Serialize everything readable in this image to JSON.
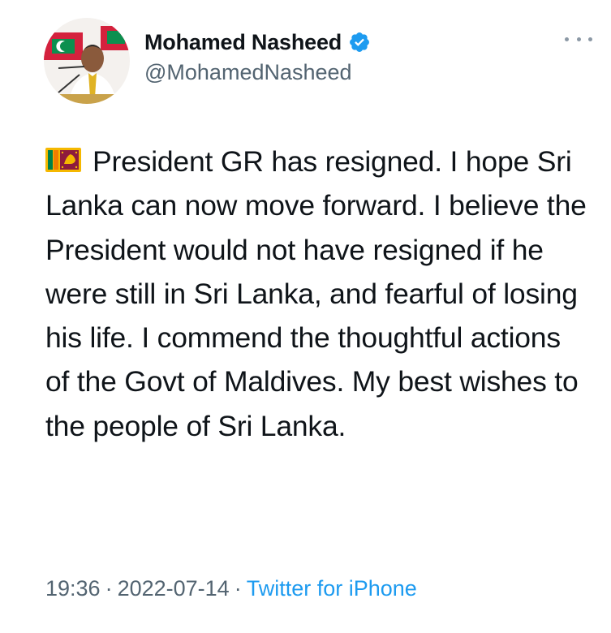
{
  "author": {
    "display_name": "Mohamed Nasheed",
    "handle": "@MohamedNasheed",
    "verified": true,
    "avatar_icon": "profile-photo-avatar",
    "verified_icon": "verified-badge-icon",
    "verified_color": "#1d9bf0"
  },
  "menu": {
    "icon": "more-options-icon"
  },
  "tweet": {
    "flag_icon": "sri-lanka-flag-emoji",
    "text": "President GR has resigned. I hope Sri Lanka can now move forward. I believe the President would not have resigned if he were still in Sri Lanka, and fearful of losing his life. I commend the thoughtful actions of the Govt of Maldives. My best wishes to the people of Sri Lanka."
  },
  "meta": {
    "time": "19:36",
    "separator": "·",
    "date": "2022-07-14",
    "source": "Twitter for iPhone",
    "source_color": "#1d9bf0"
  }
}
